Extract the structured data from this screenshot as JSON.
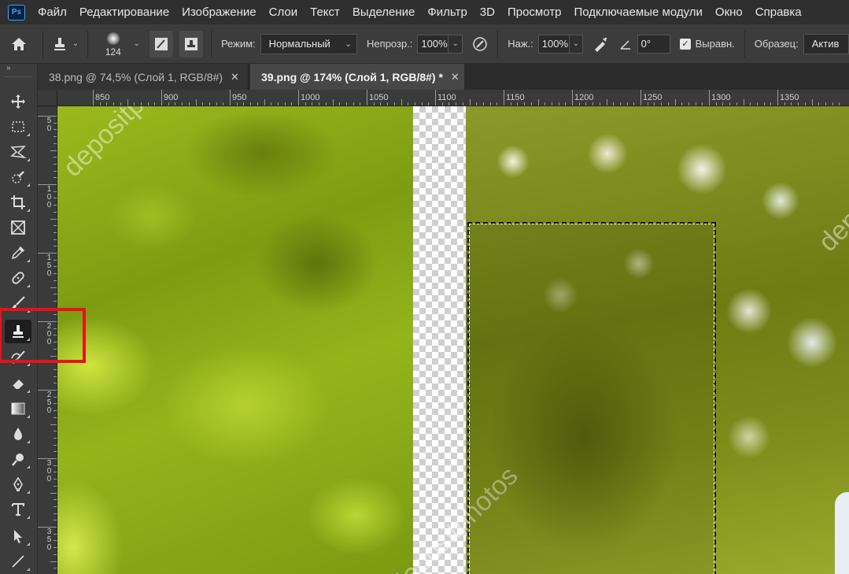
{
  "app": {
    "logo_text": "Ps",
    "menu": [
      "Файл",
      "Редактирование",
      "Изображение",
      "Слои",
      "Текст",
      "Выделение",
      "Фильтр",
      "3D",
      "Просмотр",
      "Подключаемые модули",
      "Окно",
      "Справка"
    ]
  },
  "options_bar": {
    "brush_size": "124",
    "mode_label": "Режим:",
    "mode_value": "Нормальный",
    "opacity_label": "Непрозр.:",
    "opacity_value": "100%",
    "pressure_label": "Наж.:",
    "pressure_value": "100%",
    "angle_value": "0°",
    "aligned_label": "Выравн.",
    "aligned_checked": true,
    "sample_label": "Образец:",
    "sample_value": "Актив"
  },
  "tabs": [
    {
      "label": "38.png @ 74,5% (Слой 1, RGB/8#)",
      "active": false
    },
    {
      "label": "39.png @ 174% (Слой 1, RGB/8#) *",
      "active": true
    }
  ],
  "ruler_top_labels": [
    "850",
    "900",
    "950",
    "1000",
    "1050",
    "1100",
    "1150",
    "1200",
    "1250",
    "1300",
    "1350"
  ],
  "ruler_left_labels": [
    "50",
    "100",
    "150",
    "200",
    "250",
    "300",
    "350"
  ],
  "toolbar": {
    "collapse_glyph": "»",
    "tools": [
      {
        "name": "move-tool",
        "icon": "move-icon"
      },
      {
        "name": "marquee-tool",
        "icon": "rect-marquee-icon"
      },
      {
        "name": "lasso-tool",
        "icon": "lasso-icon"
      },
      {
        "name": "quick-selection-tool",
        "icon": "quick-select-icon"
      },
      {
        "name": "crop-tool",
        "icon": "crop-icon"
      },
      {
        "name": "frame-tool",
        "icon": "frame-icon"
      },
      {
        "name": "eyedropper-tool",
        "icon": "eyedropper-icon"
      },
      {
        "name": "healing-brush-tool",
        "icon": "bandage-icon"
      },
      {
        "name": "brush-tool",
        "icon": "brush-icon"
      },
      {
        "name": "clone-stamp-tool",
        "icon": "stamp-icon",
        "active": true
      },
      {
        "name": "history-brush-tool",
        "icon": "history-brush-icon"
      },
      {
        "name": "eraser-tool",
        "icon": "eraser-icon"
      },
      {
        "name": "gradient-tool",
        "icon": "gradient-icon"
      },
      {
        "name": "blur-tool",
        "icon": "drop-icon"
      },
      {
        "name": "dodge-tool",
        "icon": "dodge-icon"
      },
      {
        "name": "pen-tool",
        "icon": "pen-icon"
      },
      {
        "name": "type-tool",
        "icon": "type-icon"
      },
      {
        "name": "path-selection-tool",
        "icon": "arrow-icon"
      },
      {
        "name": "line-tool",
        "icon": "line-icon"
      }
    ]
  },
  "highlight_color": "#e8121a",
  "canvas": {
    "watermark": "depositphotos"
  }
}
